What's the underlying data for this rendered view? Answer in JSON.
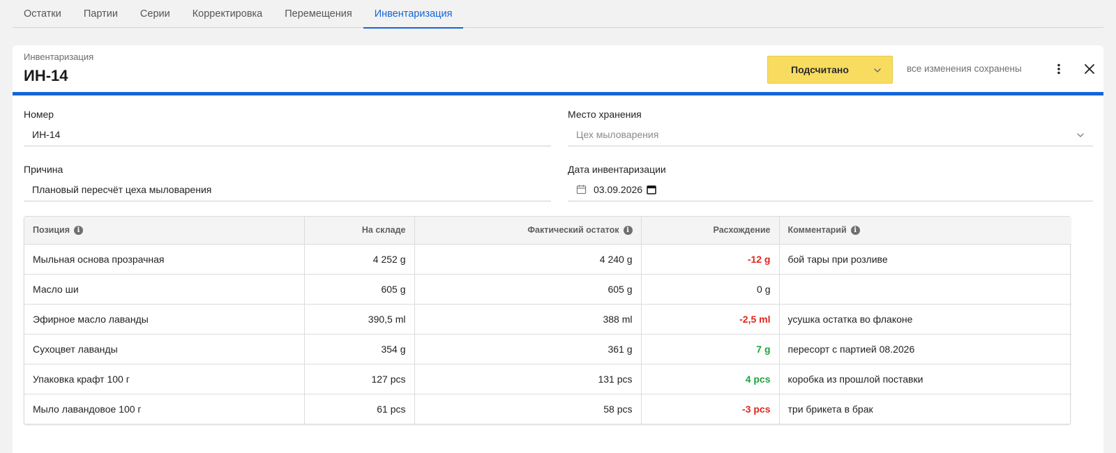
{
  "tabs": [
    {
      "label": "Остатки",
      "active": false
    },
    {
      "label": "Партии",
      "active": false
    },
    {
      "label": "Серии",
      "active": false
    },
    {
      "label": "Корректировка",
      "active": false
    },
    {
      "label": "Перемещения",
      "active": false
    },
    {
      "label": "Инвентаризация",
      "active": true
    }
  ],
  "header": {
    "subtitle": "Инвентаризация",
    "title": "ИН-14",
    "status_label": "Подсчитано",
    "status_color": "#f8dc5f",
    "saved_text": "все изменения сохранены",
    "accent_color": "#1565d8"
  },
  "form": {
    "number_label": "Номер",
    "number_value": "ИН-14",
    "storage_label": "Место хранения",
    "storage_value": "Цех мыловарения",
    "reason_label": "Причина",
    "reason_value": "Плановый пересчёт цеха мыловарения",
    "date_label": "Дата инвентаризации",
    "date_value": "03.09.2026"
  },
  "table": {
    "columns": {
      "position": "Позиция",
      "stock": "На складе",
      "actual": "Фактический остаток",
      "diff": "Расхождение",
      "comment": "Комментарий"
    },
    "rows": [
      {
        "position": "Мыльная основа прозрачная",
        "stock": "4 252 g",
        "actual": "4 240 g",
        "diff": "-12 g",
        "diff_sign": "neg",
        "comment": "бой тары при розливе"
      },
      {
        "position": "Масло ши",
        "stock": "605 g",
        "actual": "605 g",
        "diff": "0 g",
        "diff_sign": "zero",
        "comment": ""
      },
      {
        "position": "Эфирное масло лаванды",
        "stock": "390,5 ml",
        "actual": "388 ml",
        "diff": "-2,5 ml",
        "diff_sign": "neg",
        "comment": "усушка остатка во флаконе"
      },
      {
        "position": "Сухоцвет лаванды",
        "stock": "354 g",
        "actual": "361 g",
        "diff": "7 g",
        "diff_sign": "pos",
        "comment": "пересорт с партией 08.2026"
      },
      {
        "position": "Упаковка крафт 100 г",
        "stock": "127 pcs",
        "actual": "131 pcs",
        "diff": "4 pcs",
        "diff_sign": "pos",
        "comment": "коробка из прошлой поставки"
      },
      {
        "position": "Мыло лавандовое 100 г",
        "stock": "61 pcs",
        "actual": "58 pcs",
        "diff": "-3 pcs",
        "diff_sign": "neg",
        "comment": "три брикета в брак"
      }
    ]
  },
  "icons": {
    "status_chevron": "chevron-down-icon",
    "more": "more-vertical-icon",
    "close": "close-icon",
    "calendar": "calendar-icon",
    "info": "info-icon"
  },
  "colors": {
    "negative": "#e0251b",
    "positive": "#1ea43a"
  }
}
